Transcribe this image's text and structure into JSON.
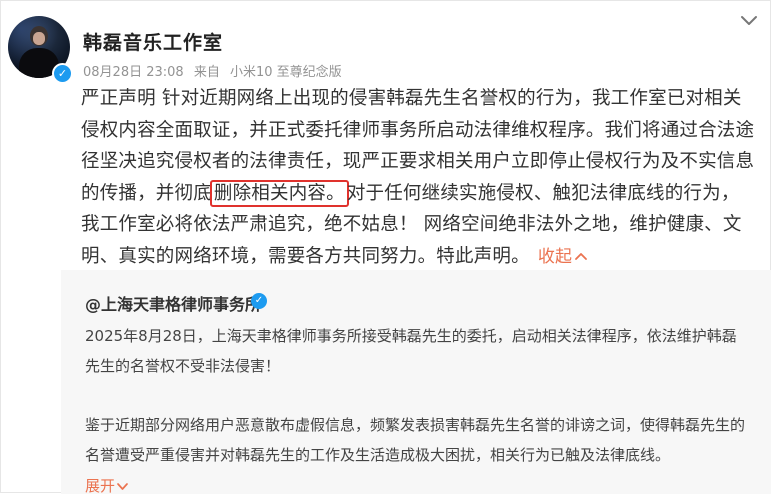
{
  "post": {
    "author": "韩磊音乐工作室",
    "date": "08月28日 23:08",
    "source_prefix": "来自",
    "source_device": "小米10 至尊纪念版",
    "text_part1": "严正声明 针对近期网络上出现的侵害韩磊先生名誉权的行为，我工作室已对相关侵权内容全面取证，并正式委托律师事务所启动法律维权程序。我们将通过合法途径坚决追究侵权者的法律责任，现严正要求相关用户立即停止侵权行为及不实信息的传播，并彻底",
    "text_highlight": "删除相关内容。",
    "text_part2": "对于任何继续实施侵权、触犯法律底线的行为，我工作室必将依法严肃追究，绝不姑息！ 网络空间绝非法外之地，维护健康、文明、真实的网络环境，需要各方共同努力。特此声明。",
    "collapse_label": "收起"
  },
  "repost": {
    "author": "@上海天聿格律师事务所",
    "paragraph1": "2025年8月28日，上海天聿格律师事务所接受韩磊先生的委托，启动相关法律程序，依法维护韩磊先生的名誉权不受非法侵害！",
    "paragraph2": "鉴于近期部分网络用户恶意散布虚假信息，频繁发表损害韩磊先生名誉的诽谤之词，使得韩磊先生的名誉遭受严重侵害并对韩磊先生的工作及生活造成极大困扰，相关行为已触及法律底线。",
    "expand_label": "展开"
  },
  "icons": {
    "menu": "chevron-down-icon",
    "verified": "verified-badge-icon",
    "collapse": "chevron-up-icon",
    "expand": "chevron-down-icon"
  },
  "colors": {
    "accent_orange": "#eb7350",
    "highlight_red": "#e0322d",
    "verified_blue": "#1d9bf0"
  }
}
